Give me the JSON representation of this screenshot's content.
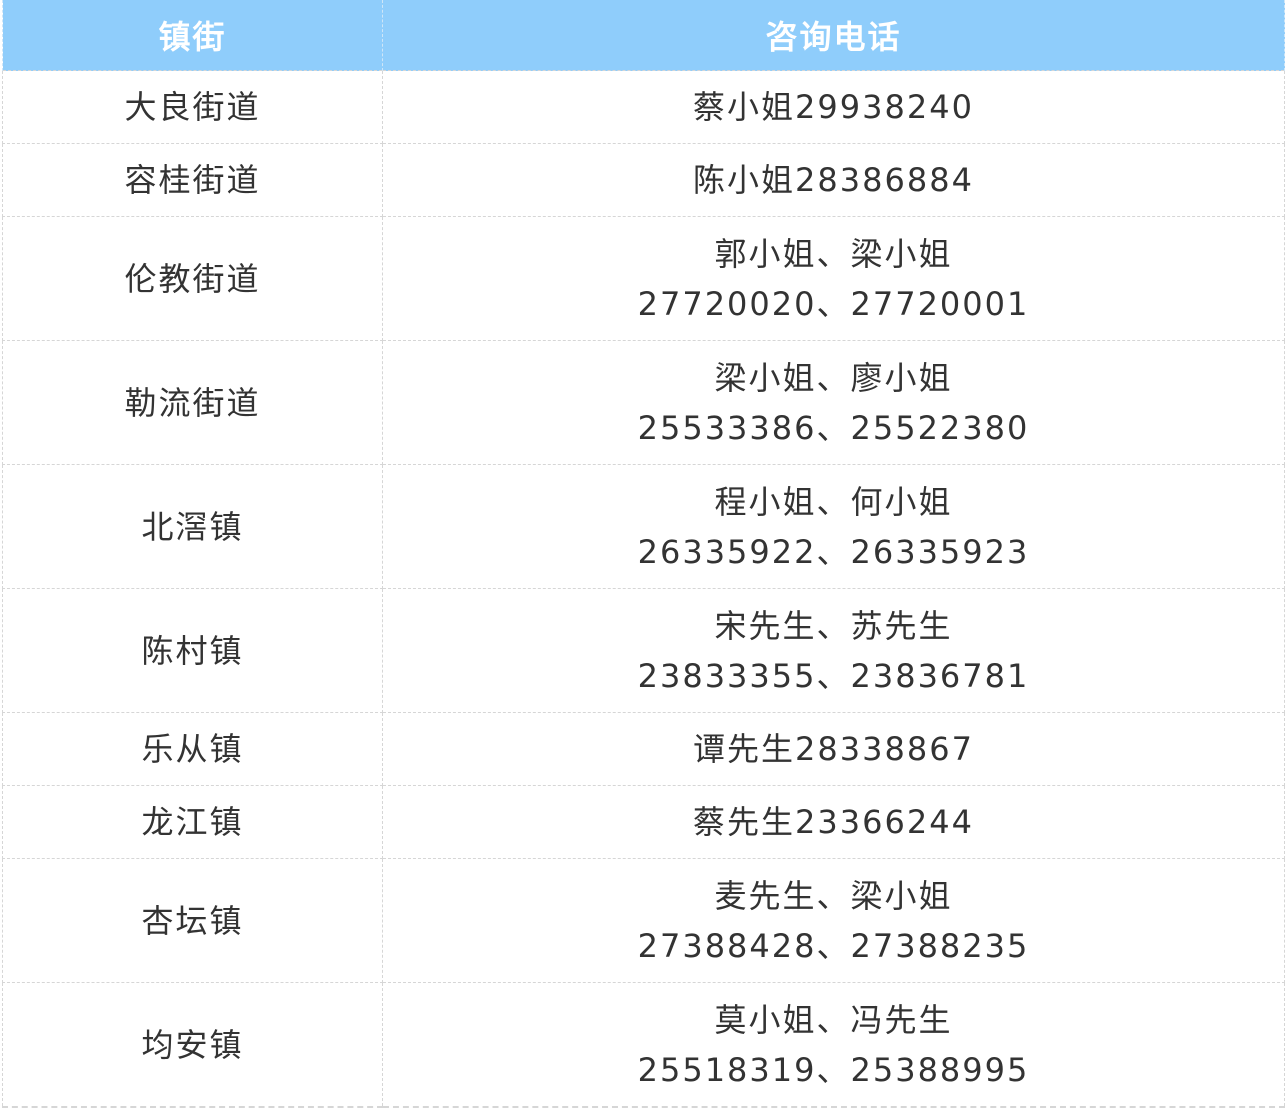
{
  "table": {
    "headers": [
      "镇街",
      "咨询电话"
    ],
    "rows": [
      {
        "town": "大良街道",
        "lines": [
          "蔡小姐29938240"
        ]
      },
      {
        "town": "容桂街道",
        "lines": [
          "陈小姐28386884"
        ]
      },
      {
        "town": "伦教街道",
        "lines": [
          "郭小姐、梁小姐",
          "27720020、27720001"
        ]
      },
      {
        "town": "勒流街道",
        "lines": [
          "梁小姐、廖小姐",
          "25533386、25522380"
        ]
      },
      {
        "town": "北滘镇",
        "lines": [
          "程小姐、何小姐",
          "26335922、26335923"
        ]
      },
      {
        "town": "陈村镇",
        "lines": [
          "宋先生、苏先生",
          "23833355、23836781"
        ]
      },
      {
        "town": "乐从镇",
        "lines": [
          "谭先生28338867"
        ]
      },
      {
        "town": "龙江镇",
        "lines": [
          "蔡先生23366244"
        ]
      },
      {
        "town": "杏坛镇",
        "lines": [
          "麦先生、梁小姐",
          "27388428、27388235"
        ]
      },
      {
        "town": "均安镇",
        "lines": [
          "莫小姐、冯先生",
          "25518319、25388995"
        ]
      }
    ]
  },
  "colors": {
    "header_bg": "#8fcdfb",
    "header_text": "#ffffff",
    "body_text": "#333333",
    "border": "#d6d6d6"
  }
}
